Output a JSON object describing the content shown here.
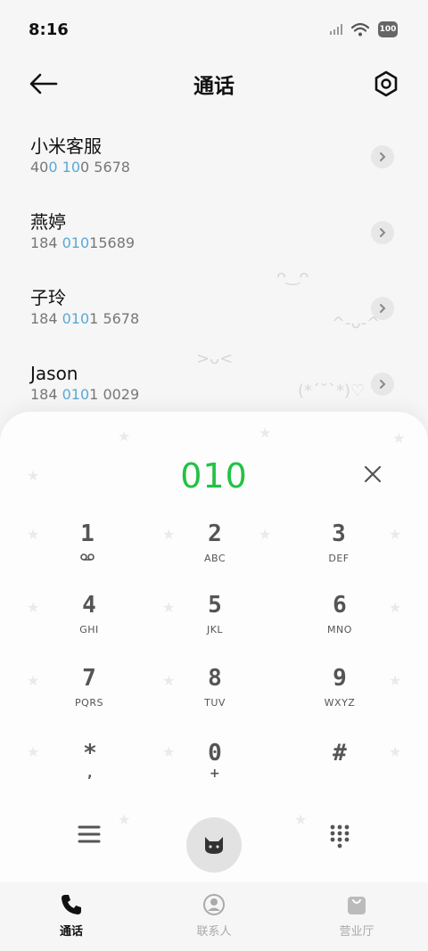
{
  "status_bar": {
    "time": "8:16",
    "battery": "100"
  },
  "header": {
    "title": "通话"
  },
  "call_list": [
    {
      "name": "小米客服",
      "number_parts": [
        "40",
        "0",
        " ",
        "10",
        "0 5678"
      ]
    },
    {
      "name": "燕婷",
      "number_parts": [
        "184 ",
        "010",
        "15689",
        "",
        ""
      ]
    },
    {
      "name": "子玲",
      "number_parts": [
        "184 ",
        "010",
        "1 5678",
        "",
        ""
      ]
    },
    {
      "name": "Jason",
      "number_parts": [
        "184 ",
        "010",
        "1 0029",
        "",
        ""
      ]
    }
  ],
  "dialpad": {
    "input": "010",
    "keys": [
      {
        "digit": "1",
        "letters": ""
      },
      {
        "digit": "2",
        "letters": "ABC"
      },
      {
        "digit": "3",
        "letters": "DEF"
      },
      {
        "digit": "4",
        "letters": "GHI"
      },
      {
        "digit": "5",
        "letters": "JKL"
      },
      {
        "digit": "6",
        "letters": "MNO"
      },
      {
        "digit": "7",
        "letters": "PQRS"
      },
      {
        "digit": "8",
        "letters": "TUV"
      },
      {
        "digit": "9",
        "letters": "WXYZ"
      },
      {
        "digit": "*",
        "letters": ","
      },
      {
        "digit": "0",
        "letters": "+"
      },
      {
        "digit": "#",
        "letters": ""
      }
    ]
  },
  "bottom_nav": [
    {
      "label": "通话",
      "icon": "phone-icon",
      "active": true
    },
    {
      "label": "联系人",
      "icon": "contact-icon",
      "active": false
    },
    {
      "label": "营业厅",
      "icon": "store-bag-icon",
      "active": false
    }
  ],
  "decorations": [
    "(*ˊ˘ˋ*)♡",
    ">ᴗ<",
    "^-ᴗ-^",
    "ᴖ‿ᴖ"
  ],
  "colors": {
    "accent_green": "#22c244",
    "highlight_blue": "#5aa8d8"
  }
}
